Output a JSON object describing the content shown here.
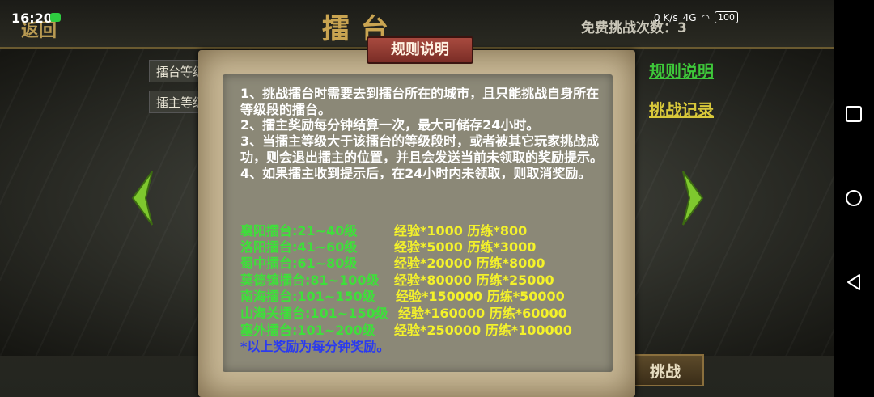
{
  "status_bar": {
    "time": "16:20",
    "net_speed": "0 K/s",
    "signal": "4G",
    "battery": "100"
  },
  "header": {
    "back_label": "返回",
    "title": "擂台",
    "free_challenge_label": "免费挑战次数：3"
  },
  "side_tags": [
    "擂台等级",
    "擂主等级"
  ],
  "links": {
    "rules": "规则说明",
    "records": "挑战记录"
  },
  "challenge_button": "挑战",
  "dialog": {
    "title": "规则说明",
    "rules": [
      "1、挑战擂台时需要去到擂台所在的城市，且只能挑战自身所在等级段的擂台。",
      "2、擂主奖励每分钟结算一次，最大可储存24小时。",
      "3、当擂主等级大于该擂台的等级段时，或者被其它玩家挑战成功，则会退出擂主的位置，并且会发送当前未领取的奖励提示。",
      "4、如果擂主收到提示后，在24小时内未领取，则取消奖励。"
    ],
    "rewards": [
      {
        "name": "襄阳擂台:21~40级",
        "value": "经验*1000  历练*800"
      },
      {
        "name": "洛阳擂台:41~60级",
        "value": "经验*5000  历练*3000"
      },
      {
        "name": "蜀中擂台:61~80级",
        "value": "经验*20000  历练*8000"
      },
      {
        "name": "莫德镇擂台:81~100级",
        "value": "经验*80000  历练*25000"
      },
      {
        "name": "南海擂台:101~150级",
        "value": "经验*150000  历练*50000"
      },
      {
        "name": "山海关擂台:101~150级",
        "value": "经验*160000  历练*60000"
      },
      {
        "name": "塞外擂台:101~200级",
        "value": "经验*250000  历练*100000"
      }
    ],
    "footnote": "*以上奖励为每分钟奖励。"
  },
  "icons": {
    "left_arrow": "chevron-left-icon",
    "right_arrow": "chevron-right-icon",
    "nav_recent": "square-icon",
    "nav_home": "circle-icon",
    "nav_back": "triangle-back-icon"
  },
  "colors": {
    "reward_name": "#3ee03a",
    "reward_value": "#f4f22a",
    "footnote": "#2a3af0",
    "dialog_title_bg": "#a84a3f",
    "link_green": "#3ec83a",
    "link_yellow": "#d8c83a"
  }
}
